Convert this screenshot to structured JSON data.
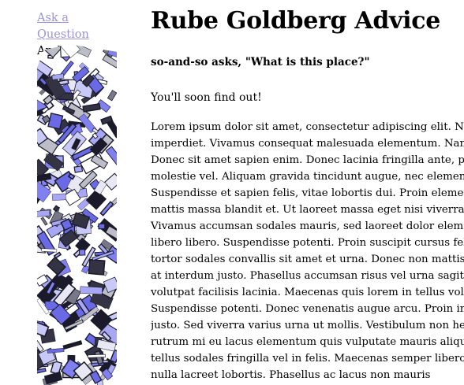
{
  "sidebar": {
    "ask_link": "Ask a Question",
    "archive_label": "Archive"
  },
  "main": {
    "title": "Rube Goldberg Advice",
    "question": "so-and-so asks, \"What is this place?\"",
    "answer": "You'll soon find out!",
    "body_lines": [
      "Lorem ipsum dolor sit amet, consectetur adipiscing elit. Nu",
      "imperdiet. Vivamus consequat malesuada elementum. Nam",
      "Donec sit amet sapien enim. Donec lacinia fringilla ante, po",
      "molestie vel. Aliquam gravida tincidunt augue, nec element",
      "Suspendisse et sapien felis, vitae lobortis dui. Proin elemen",
      "mattis massa blandit et. Ut laoreet massa eget nisi viverra i",
      "Vivamus accumsan sodales mauris, sed laoreet dolor elemen",
      "libero libero. Suspendisse potenti. Proin suscipit cursus feli",
      "tortor sodales convallis sit amet et urna. Donec non mattis r",
      "at interdum justo. Phasellus accumsan risus vel urna sagitti",
      "volutpat facilisis lacinia. Maecenas quis lorem in tellus volu",
      "Suspendisse potenti. Donec venenatis augue arcu. Proin in s",
      "justo. Sed viverra varius urna ut mollis. Vestibulum non he",
      "rutrum mi eu lacus elementum quis vulputate mauris aliqu",
      "tellus sodales fringilla vel in felis. Maecenas semper libero lu",
      "nulla lacreet lobortis. Phasellus ac lacus non mauris"
    ]
  },
  "colors": {
    "link": "#9b95d6",
    "art_blue": "#8080f0",
    "art_dark": "#1a1a2a"
  },
  "icons": {
    "art": "abstract-collage-image"
  }
}
